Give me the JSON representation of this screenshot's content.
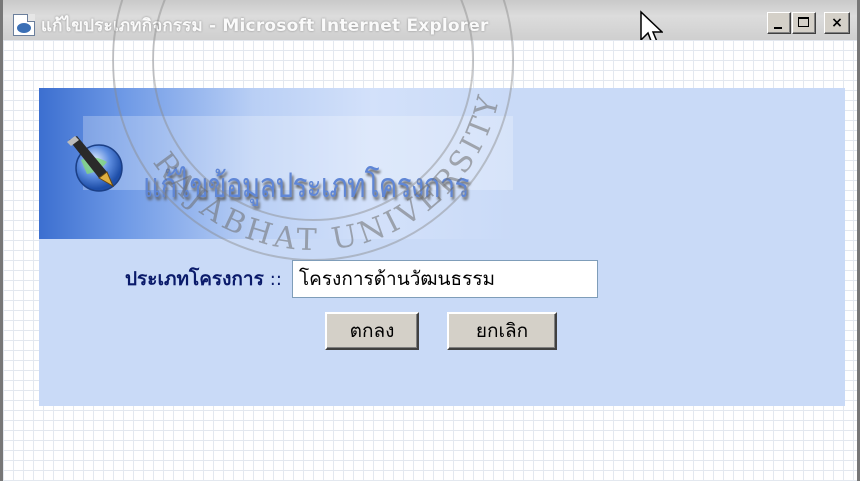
{
  "window": {
    "title": "แก้ไขประเภทกิจกรรม - Microsoft Internet Explorer",
    "controls": {
      "minimize": "minimize",
      "maximize": "maximize",
      "close": "×"
    }
  },
  "watermark": {
    "text": "RAJABHAT UNIVERSITY"
  },
  "banner": {
    "title": "แก้ไขข้อมูลประเภทโครงการ",
    "icon": "pen-globe-icon"
  },
  "form": {
    "label": "ประเภทโครงการ",
    "separator": "::",
    "input_value": "โครงการด้านวัฒนธรรม",
    "ok_label": "ตกลง",
    "cancel_label": "ยกเลิก"
  },
  "colors": {
    "panel": "#c9daf7",
    "banner_text": "#5f86d6",
    "label_text": "#0a1a6a"
  }
}
